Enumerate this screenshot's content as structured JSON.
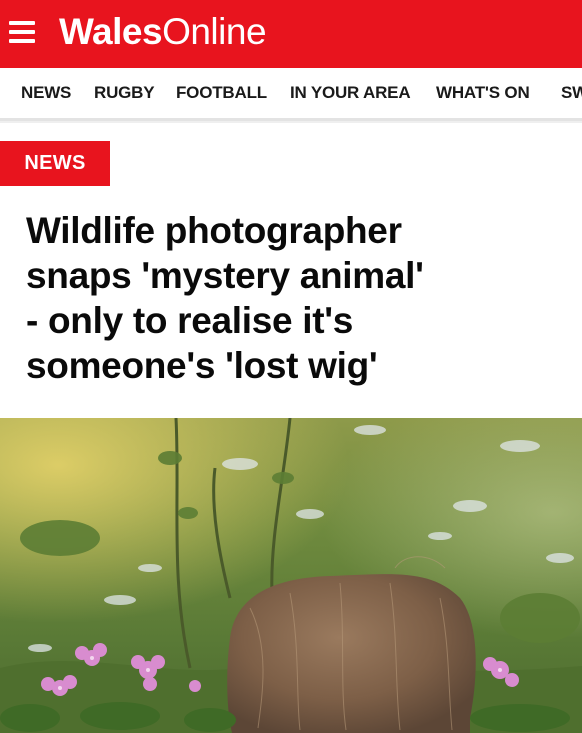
{
  "header": {
    "brand_bold": "Wales",
    "brand_light": "Online",
    "brand_color": "#e8141e"
  },
  "nav": {
    "items": [
      "NEWS",
      "RUGBY",
      "FOOTBALL",
      "IN YOUR AREA",
      "WHAT'S ON",
      "SW"
    ]
  },
  "article": {
    "category": "NEWS",
    "headline_lines": [
      "Wildlife photographer",
      "snaps 'mystery animal'",
      "- only to realise it's",
      "someone's 'lost wig'"
    ]
  },
  "icons": {
    "menu": "hamburger-menu-icon"
  }
}
